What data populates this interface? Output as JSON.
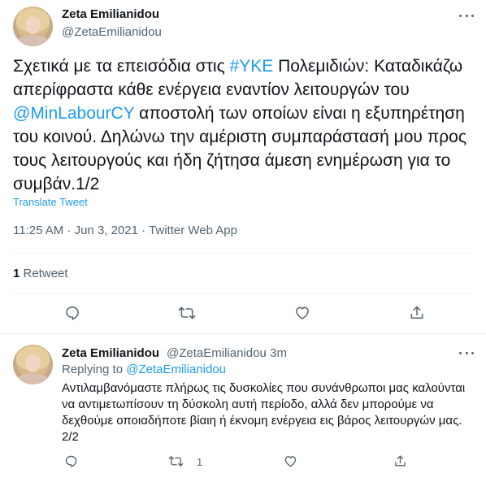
{
  "main_tweet": {
    "author_name": "Zeta Emilianidou",
    "author_handle": "@ZetaEmilianidou",
    "text_parts": {
      "p1": "Σχετικά με τα επεισόδια στις ",
      "hashtag": "#ΥΚΕ",
      "p2": " Πολεμιδιών: Καταδικάζω απερίφραστα κάθε ενέργεια εναντίον λειτουργών του ",
      "mention": "@MinLabourCY",
      "p3": " αποστολή των οποίων είναι η εξυπηρέτηση του κοινού. Δηλώνω την αμέριστη συμπαράστασή μου προς τους λειτουργούς και ήδη ζήτησα άμεση ενημέρωση για το συμβάν.1/2"
    },
    "translate_label": "Translate Tweet",
    "timestamp": "11:25 AM · Jun 3, 2021 · Twitter Web App",
    "retweet_count": "1",
    "retweet_label": "Retweet"
  },
  "reply_tweet": {
    "author_name": "Zeta Emilianidou",
    "author_handle": "@ZetaEmilianidou",
    "time": "· 3m",
    "replying_to_label": "Replying to ",
    "replying_to_handle": "@ZetaEmilianidou",
    "text": "Αντιλαμβανόμαστε πλήρως τις δυσκολίες που συνάνθρωποι μας καλούνται να αντιμετωπίσουν τη δύσκολη αυτή περίοδο, αλλά δεν μπορούμε να δεχθούμε οποιαδήποτε βίαιη ή έκνομη ενέργεια εις βάρος λειτουργών μας. 2/2",
    "retweet_count": "1"
  },
  "icons": {
    "more": "more-icon",
    "reply": "reply-icon",
    "retweet": "retweet-icon",
    "like": "like-icon",
    "share": "share-icon"
  },
  "colors": {
    "accent": "#1d9bf0",
    "text": "#0f1419",
    "secondary": "#536471",
    "divider": "#eff3f4"
  }
}
